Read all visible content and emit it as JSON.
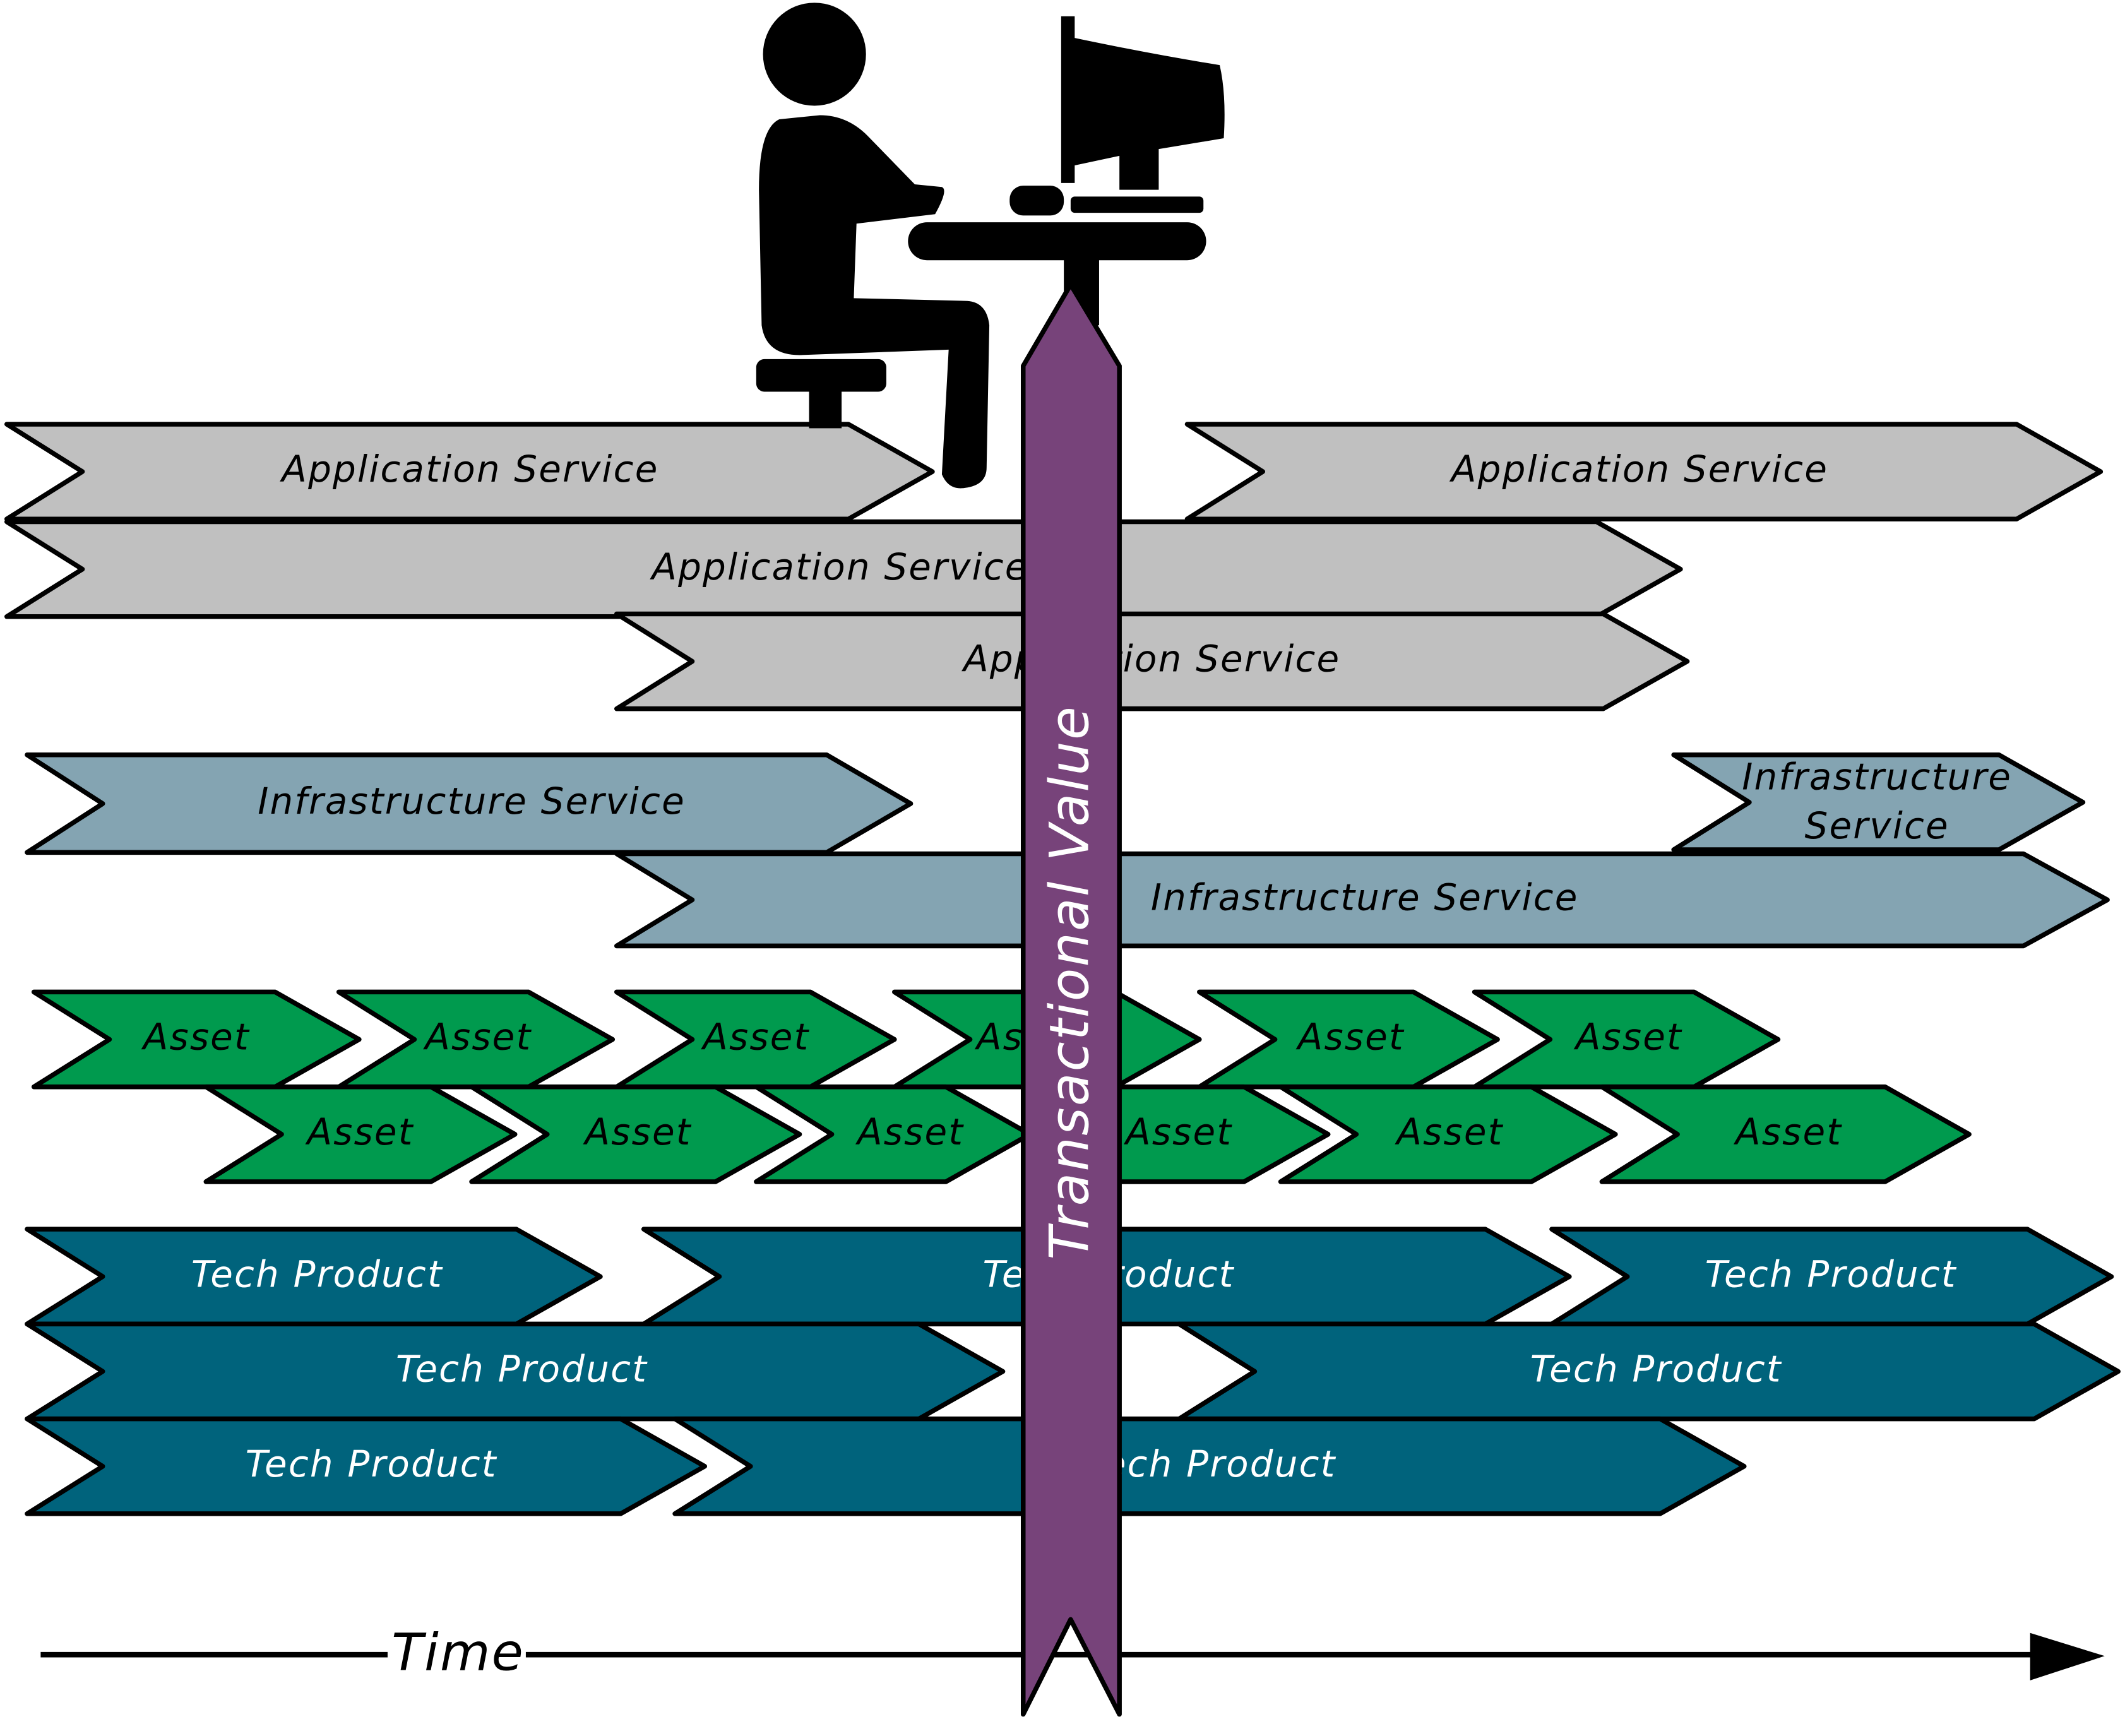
{
  "colors": {
    "application_service": "#c0c0c0",
    "infrastructure_service": "#84a4b2",
    "asset": "#009a4e",
    "tech_product": "#00637c",
    "transactional_value": "#77437a"
  },
  "icons": [
    "person-at-computer-icon",
    "time-arrow-icon"
  ],
  "application_services": [
    {
      "label": "Application Service"
    },
    {
      "label": "Application Service"
    },
    {
      "label": "Application Service"
    },
    {
      "label": "Application Service"
    }
  ],
  "infrastructure_services": [
    {
      "label": "Infrastructure Service"
    },
    {
      "label": "Infrastructure Service",
      "lines": [
        "Infrastructure",
        "Service"
      ]
    },
    {
      "label": "Infrastructure Service"
    }
  ],
  "assets": [
    {
      "label": "Asset"
    },
    {
      "label": "Asset"
    },
    {
      "label": "Asset"
    },
    {
      "label": "Asset"
    },
    {
      "label": "Asset"
    },
    {
      "label": "Asset"
    },
    {
      "label": "Asset"
    },
    {
      "label": "Asset"
    },
    {
      "label": "Asset"
    },
    {
      "label": "Asset"
    },
    {
      "label": "Asset"
    },
    {
      "label": "Asset"
    }
  ],
  "tech_products": [
    {
      "label": "Tech Product"
    },
    {
      "label": "Tech Product"
    },
    {
      "label": "Tech Product"
    },
    {
      "label": "Tech Product"
    },
    {
      "label": "Tech Product"
    },
    {
      "label": "Tech Product"
    },
    {
      "label": "Tech Product"
    }
  ],
  "transactional_value": {
    "label": "Transactional Value"
  },
  "time_axis": {
    "label": "Time"
  }
}
